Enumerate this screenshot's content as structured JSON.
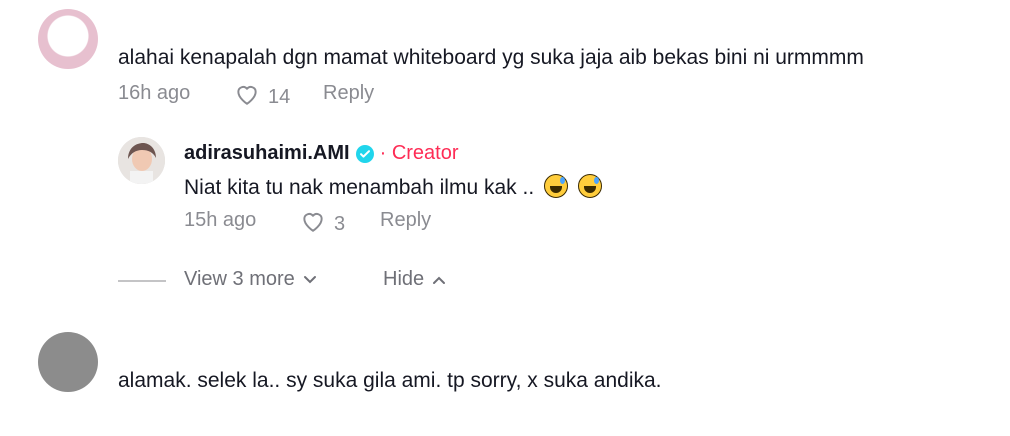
{
  "comments": [
    {
      "text": "alahai kenapalah dgn mamat whiteboard yg suka jaja aib bekas bini ni urmmmm",
      "time": "16h ago",
      "likes": "14",
      "reply_label": "Reply",
      "replies": [
        {
          "username": "adirasuhaimi.AMI",
          "creator_label": "· Creator",
          "text": "Niat kita tu nak menambah ilmu kak ..",
          "time": "15h ago",
          "likes": "3",
          "reply_label": "Reply"
        }
      ],
      "view_more_label": "View 3 more",
      "hide_label": "Hide"
    },
    {
      "text": "alamak. selek la.. sy suka gila ami. tp sorry, x suka andika."
    }
  ],
  "colors": {
    "creator": "#fe2c55",
    "verified": "#20d5ec",
    "muted": "#8a8b91"
  }
}
